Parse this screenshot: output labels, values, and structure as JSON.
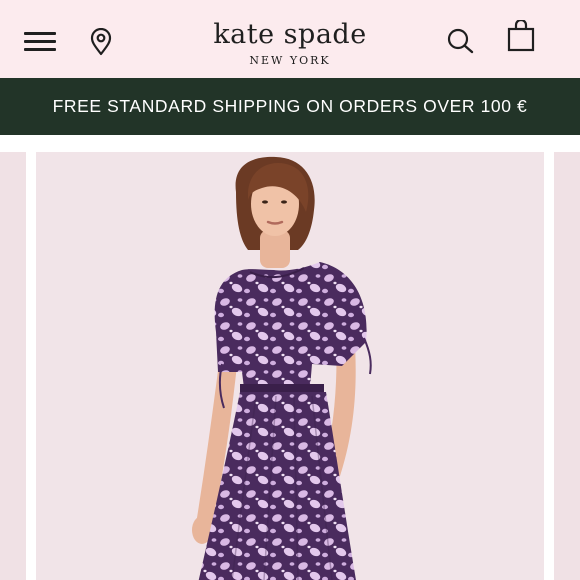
{
  "header": {
    "brand": "kate spade",
    "city": "NEW YORK",
    "icons": [
      "menu-icon",
      "location-pin-icon",
      "search-icon",
      "shopping-bag-icon"
    ]
  },
  "promo_banner": {
    "text": "FREE STANDARD SHIPPING ON ORDERS OVER 100 €"
  },
  "colors": {
    "header_bg": "#fcebee",
    "banner_bg": "#223428",
    "banner_text": "#ffffff",
    "slide_bg": "#f1e4e8",
    "dress_dark": "#4a2b5e",
    "dress_light": "#d9b9e4"
  }
}
